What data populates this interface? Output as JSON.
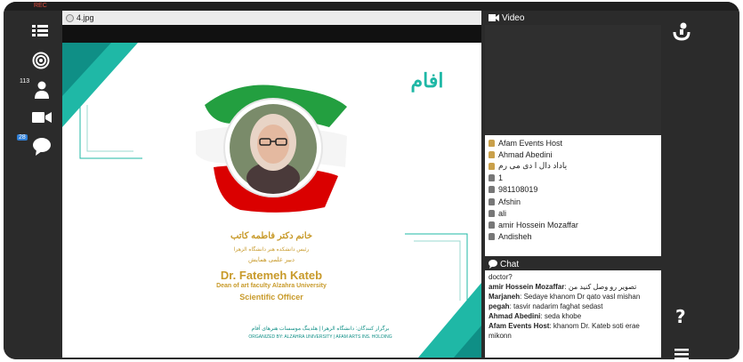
{
  "topbar": {
    "rec_label": "REC"
  },
  "leftbar": {
    "user_count": "113",
    "chat_count": "28"
  },
  "presentation": {
    "file_name": "4.jpg"
  },
  "slide": {
    "logo_text": "افام",
    "persian_name": "خانم دکتر فاطمه کاتب",
    "persian_title": "رئیس دانشکده هنر دانشگاه الزهرا",
    "persian_role": "دبیر علمی همایش",
    "name": "Dr. Fatemeh Kateb",
    "title": "Dean of art faculty Alzahra University",
    "role": "Scientific Officer",
    "footer_fa": "برگزار کنندگان: دانشگاه الزهرا | هلدینگ موسسات هنرهای آفام",
    "footer_en": "ORGANIZED BY: ALZAHRA UNIVERSITY | AFAM ARTS INS. HOLDING"
  },
  "video": {
    "title": "Video"
  },
  "users": [
    {
      "name": "Afam Events Host",
      "role": "host"
    },
    {
      "name": "Ahmad Abedini",
      "role": "host"
    },
    {
      "name": "یاداد دال ا دی می رم",
      "role": "host"
    },
    {
      "name": "1",
      "role": "viewer"
    },
    {
      "name": "981108019",
      "role": "viewer"
    },
    {
      "name": "Afshin",
      "role": "viewer"
    },
    {
      "name": "ali",
      "role": "viewer"
    },
    {
      "name": "amir Hossein Mozaffar",
      "role": "viewer"
    },
    {
      "name": "Andisheh",
      "role": "viewer"
    }
  ],
  "chat": {
    "title": "Chat",
    "messages": [
      {
        "author": "",
        "text": "doctor?"
      },
      {
        "author": "amir Hossein Mozaffar",
        "text": "تصویر رو وصل کنید من"
      },
      {
        "author": "Marjaneh",
        "text": "Sedaye khanom Dr qato vasl mishan"
      },
      {
        "author": "pegah",
        "text": "tasvir nadarim faghat sedast"
      },
      {
        "author": "Ahmad Abedini",
        "text": "seda khobe"
      },
      {
        "author": "Afam Events Host",
        "text": "khanom Dr. Kateb soti erae mikonn"
      }
    ]
  },
  "rightbar": {
    "help_label": "?"
  },
  "colors": {
    "accent_teal": "#1fb8a6",
    "flag_green": "#239f40",
    "flag_red": "#da0000",
    "gold_text": "#c89a2a",
    "dark_teal": "#0f8f86"
  }
}
